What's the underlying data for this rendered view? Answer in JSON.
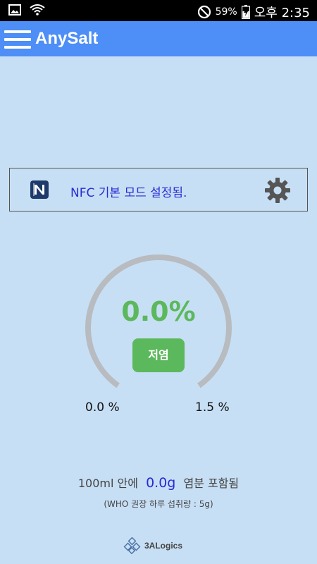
{
  "status_bar": {
    "battery_percent": "59%",
    "time": "오후 2:35"
  },
  "app_bar": {
    "title": "AnySalt"
  },
  "nfc": {
    "message": "NFC 기본 모드 설정됨."
  },
  "gauge": {
    "value_text": "0.0%",
    "value": 0.0,
    "level_label": "저염",
    "min_label": "0.0 %",
    "max_label": "1.5 %",
    "track_color": "#b8bbbf",
    "value_color": "#5cb85c"
  },
  "salt_info": {
    "prefix": "100ml 안에",
    "amount": "0.0g",
    "suffix": "염분 포함됨",
    "who_note": "(WHO 권장 하루 섭취량 : 5g)"
  },
  "footer": {
    "logo_text": "3ALogics"
  },
  "icons": {
    "menu": "hamburger-icon",
    "nfc": "nfc-icon",
    "settings": "gear-icon"
  }
}
